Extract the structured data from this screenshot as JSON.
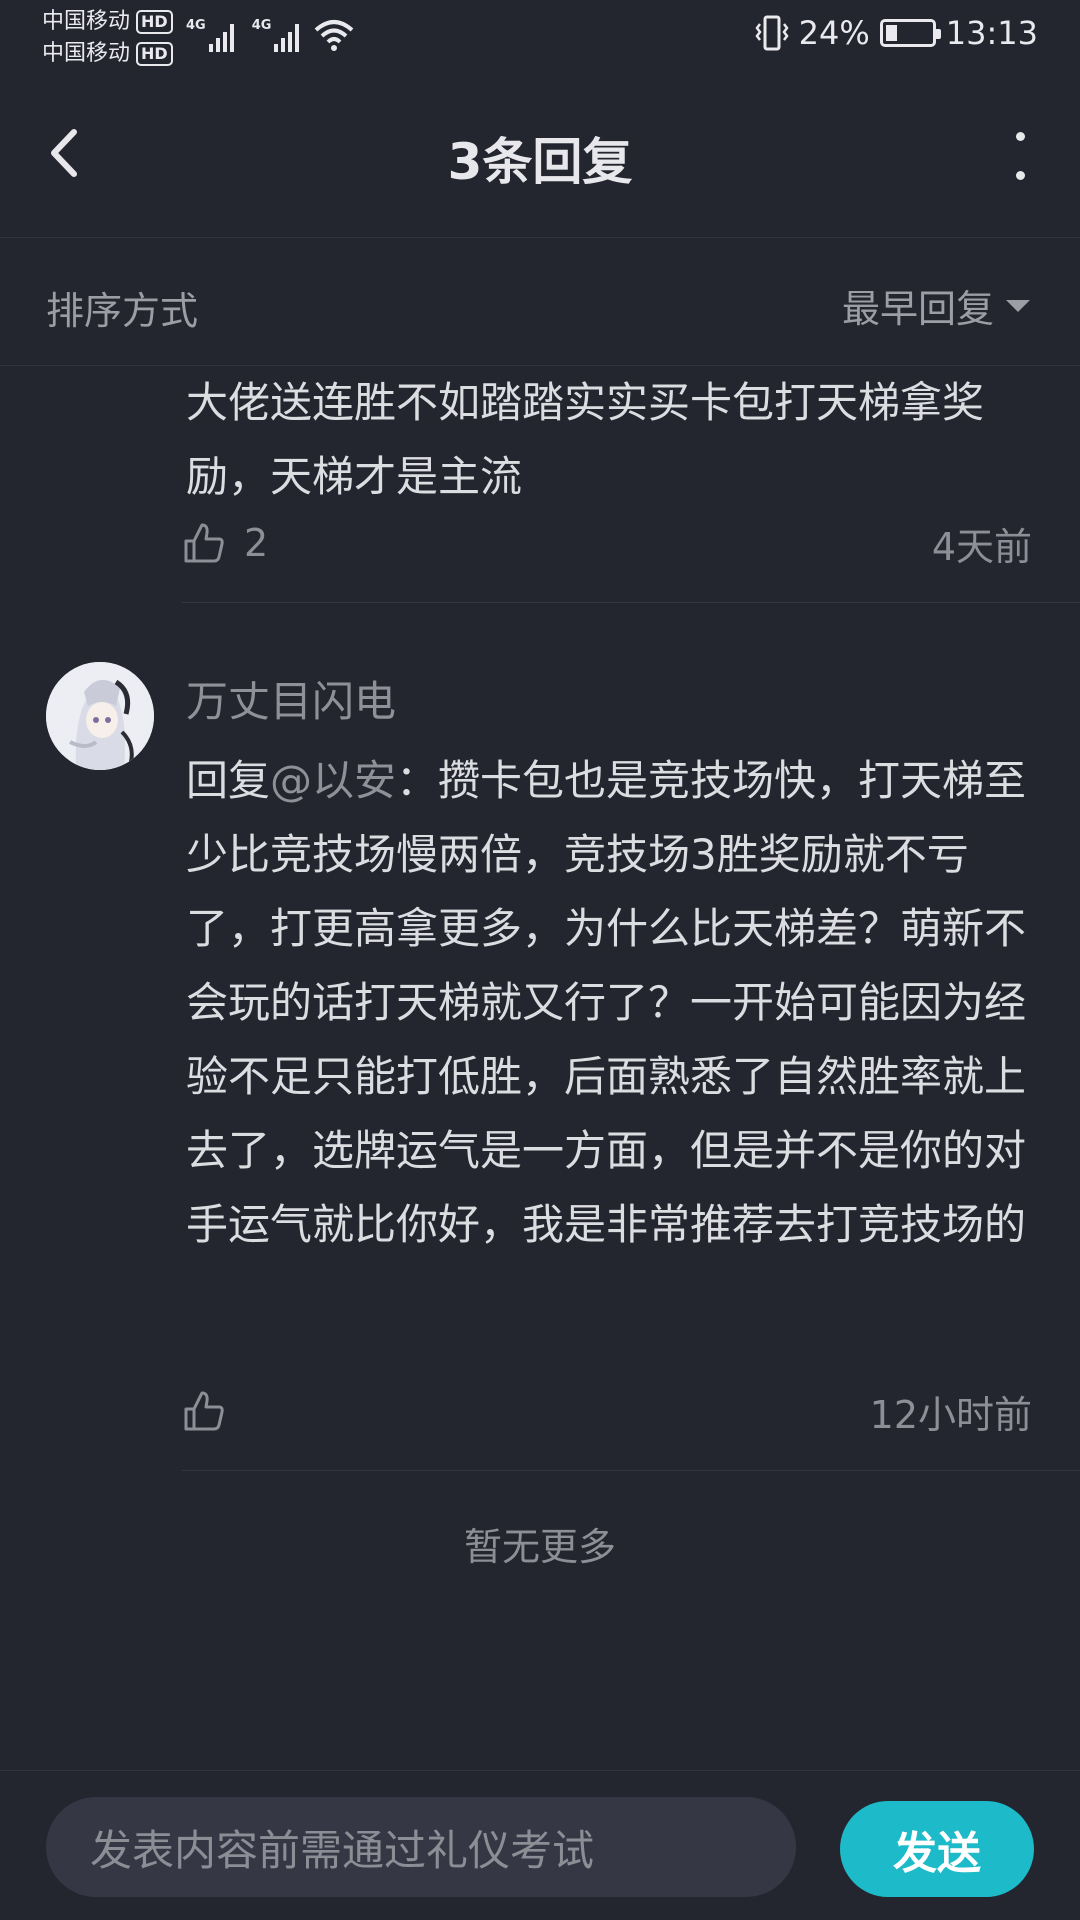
{
  "status_bar": {
    "carrier_1": "中国移动",
    "carrier_2": "中国移动",
    "hd": "HD",
    "network": "4G",
    "battery": "24%",
    "battery_level": 0.24,
    "time": "13:13"
  },
  "header": {
    "title": "3条回复",
    "back_icon": "chevron-left-icon",
    "more_icon": "more-vertical-icon"
  },
  "sort": {
    "label": "排序方式",
    "selected": "最早回复"
  },
  "replies": [
    {
      "text": "大佬送连胜不如踏踏实实买卡包打天梯拿奖励，天梯才是主流",
      "likes": "2",
      "time": "4天前"
    },
    {
      "username": "万丈目闪电",
      "prefix": "回复",
      "mention": "@以安",
      "text": "：攒卡包也是竞技场快，打天梯至少比竞技场慢两倍，竞技场3胜奖励就不亏了，打更高拿更多，为什么比天梯差？萌新不会玩的话打天梯就又行了？一开始可能因为经验不足只能打低胜，后面熟悉了自然胜率就上去了，选牌运气是一方面，但是并不是你的对手运气就比你好，我是非常推荐去打竞技场的",
      "likes": "",
      "time": "12小时前"
    }
  ],
  "footer_note": "暂无更多",
  "composer": {
    "placeholder": "发表内容前需通过礼仪考试",
    "send_label": "发送"
  },
  "colors": {
    "background": "#24262f",
    "accent": "#1dbbc9",
    "text_primary": "#dcdde1",
    "text_secondary": "#8d8f97"
  }
}
